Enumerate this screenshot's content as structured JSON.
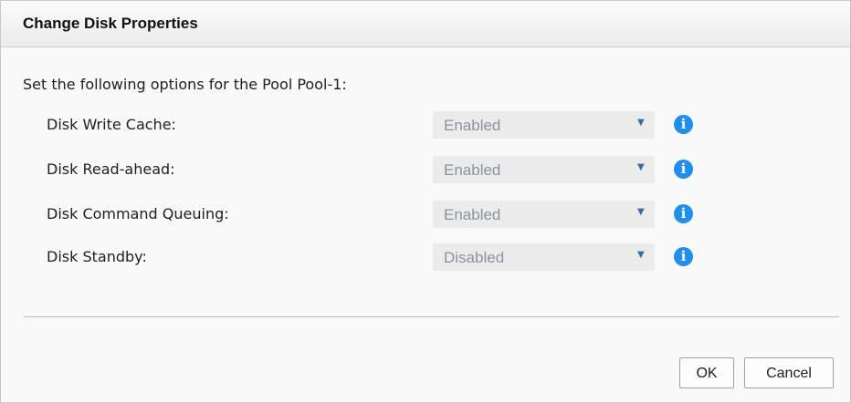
{
  "dialog": {
    "title": "Change Disk Properties",
    "intro": "Set the following options for the Pool Pool-1:"
  },
  "options": [
    {
      "label": "Disk Write Cache:",
      "value": "Enabled",
      "arrow": "▼",
      "info": "i"
    },
    {
      "label": "Disk Read-ahead:",
      "value": "Enabled",
      "arrow": "▼",
      "info": "i"
    },
    {
      "label": "Disk Command Queuing:",
      "value": "Enabled",
      "arrow": "▼",
      "info": "i"
    },
    {
      "label": "Disk Standby:",
      "value": "Disabled",
      "arrow": "▼",
      "info": "i"
    }
  ],
  "buttons": {
    "ok": "OK",
    "cancel": "Cancel"
  },
  "icons": {
    "info": "info-circle-icon",
    "dropdown": "chevron-down-icon"
  },
  "colors": {
    "info_icon": "#1f8ef1",
    "dropdown_arrow": "#2f6fad",
    "select_bg": "#ebebeb",
    "select_text": "#8a93a1"
  }
}
